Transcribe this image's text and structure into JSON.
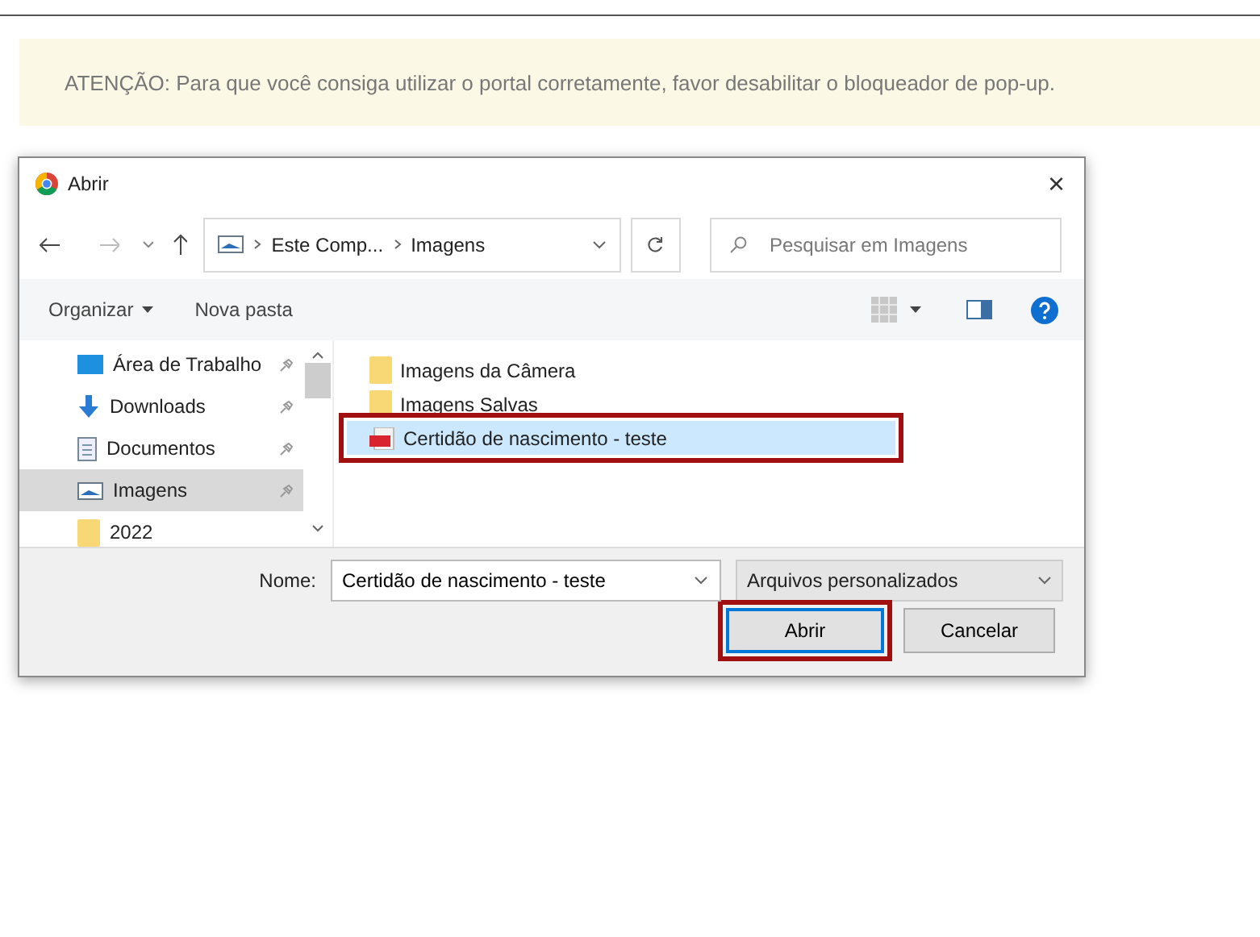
{
  "notice": "ATENÇÃO: Para que você consiga utilizar o portal corretamente, favor desabilitar o bloqueador de pop-up.",
  "dialog": {
    "title": "Abrir",
    "close": "×",
    "address": [
      "Este Comp...",
      "Imagens"
    ],
    "search": {
      "placeholder": "Pesquisar em Imagens"
    },
    "toolbar": [
      {
        "label": "Organizar",
        "menu": true
      },
      {
        "label": "Nova pasta",
        "menu": false
      }
    ],
    "nav_items": [
      {
        "label": "Área de Trabalho",
        "kind": "desktop",
        "pinned": true,
        "selected": false
      },
      {
        "label": "Downloads",
        "kind": "download",
        "pinned": true,
        "selected": false
      },
      {
        "label": "Documentos",
        "kind": "documents",
        "pinned": true,
        "selected": false
      },
      {
        "label": "Imagens",
        "kind": "pictures",
        "pinned": true,
        "selected": true
      },
      {
        "label": "2022",
        "kind": "folder",
        "pinned": false,
        "selected": false
      }
    ],
    "files": [
      {
        "name": "Imagens da Câmera",
        "kind": "folder",
        "selected": false,
        "highlighted": false
      },
      {
        "name": "Imagens Salvas",
        "kind": "folder",
        "selected": false,
        "highlighted": false
      },
      {
        "name": "Certidão de nascimento - teste",
        "kind": "pdf",
        "selected": true,
        "highlighted": true
      }
    ],
    "filename_label": "Nome:",
    "filename": "Certidão de nascimento - teste",
    "file_type": "Arquivos personalizados",
    "buttons": [
      {
        "label": "Abrir",
        "kind": "primary",
        "highlighted": true
      },
      {
        "label": "Cancelar",
        "kind": "secondary",
        "highlighted": false
      }
    ]
  }
}
